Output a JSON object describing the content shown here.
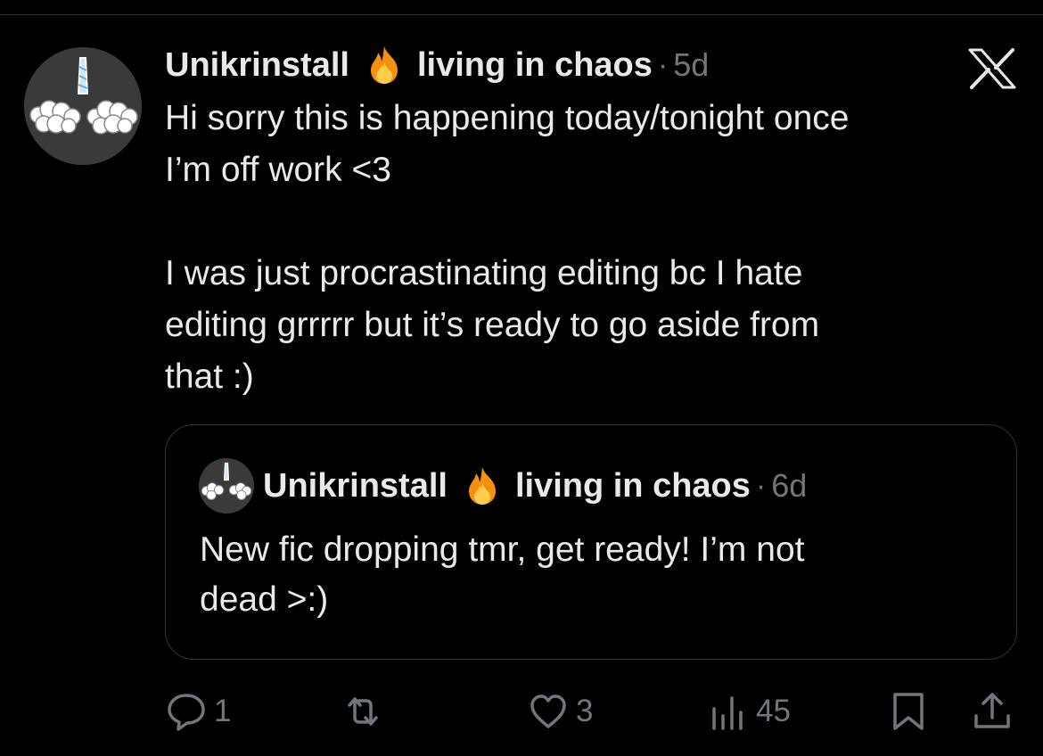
{
  "tweet": {
    "author": "Unikrinstall",
    "display_suffix": "living in chaos",
    "separator": "·",
    "time": "5d",
    "text": "Hi sorry this is happening today/tonight once\nI’m off work <3\n\nI was just procrastinating editing bc I hate\nediting grrrrr but it’s ready to go aside from\nthat :)"
  },
  "quoted_tweet": {
    "author": "Unikrinstall",
    "display_suffix": "living in chaos",
    "separator": "·",
    "time": "6d",
    "text": "New fic dropping tmr, get ready! I’m not\ndead >:)"
  },
  "actions": {
    "replies": "1",
    "likes": "3",
    "views": "45"
  },
  "icons": {
    "avatar": "unicorn-avatar-icon",
    "emoji": "fire-emoji-icon",
    "platform": "x-logo-icon",
    "reply": "reply-icon",
    "retweet": "retweet-icon",
    "like": "heart-icon",
    "views": "views-chart-icon",
    "bookmark": "bookmark-icon",
    "share": "share-icon"
  },
  "colors": {
    "background": "#000000",
    "text": "#e7e9ea",
    "secondary": "#71767b",
    "border": "#2f3336"
  }
}
